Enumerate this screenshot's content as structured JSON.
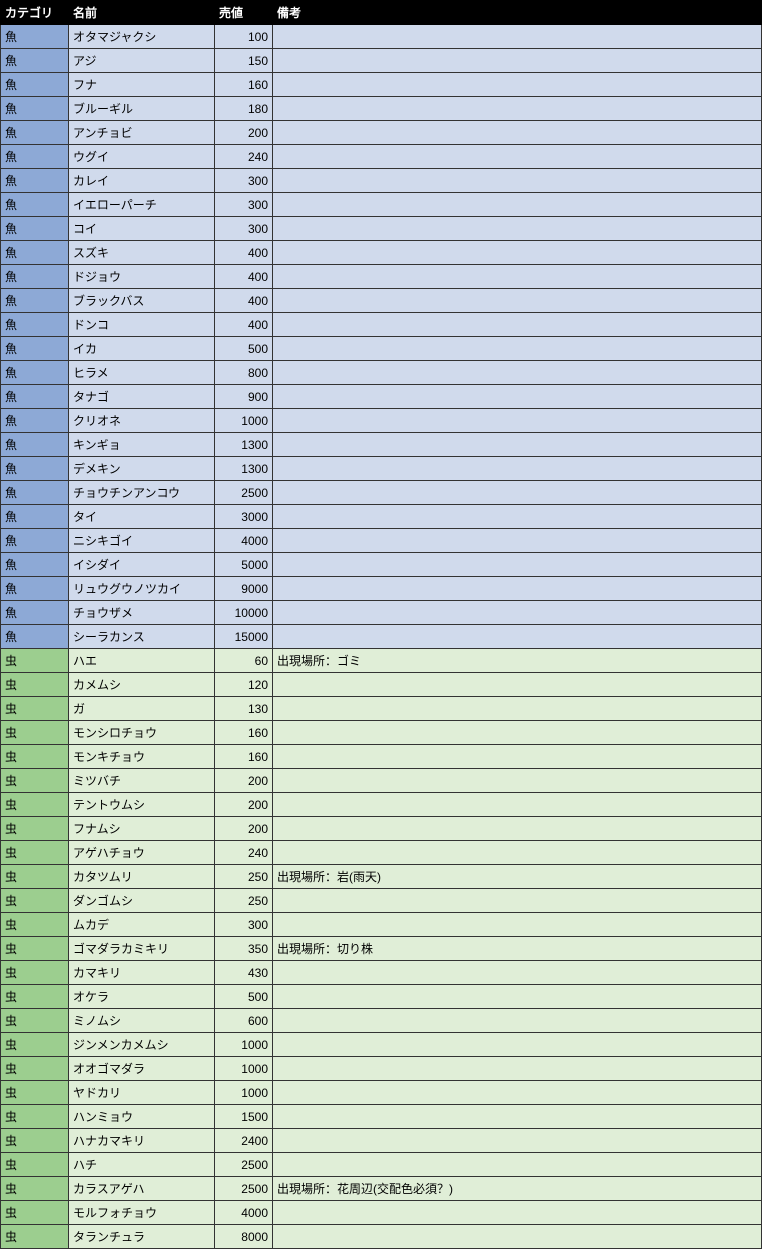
{
  "headers": {
    "category": "カテゴリ",
    "name": "名前",
    "price": "売値",
    "note": "備考"
  },
  "rows": [
    {
      "category": "魚",
      "name": "オタマジャクシ",
      "price": 100,
      "note": "",
      "type": "fish"
    },
    {
      "category": "魚",
      "name": "アジ",
      "price": 150,
      "note": "",
      "type": "fish"
    },
    {
      "category": "魚",
      "name": "フナ",
      "price": 160,
      "note": "",
      "type": "fish"
    },
    {
      "category": "魚",
      "name": "ブルーギル",
      "price": 180,
      "note": "",
      "type": "fish"
    },
    {
      "category": "魚",
      "name": "アンチョビ",
      "price": 200,
      "note": "",
      "type": "fish"
    },
    {
      "category": "魚",
      "name": "ウグイ",
      "price": 240,
      "note": "",
      "type": "fish"
    },
    {
      "category": "魚",
      "name": "カレイ",
      "price": 300,
      "note": "",
      "type": "fish"
    },
    {
      "category": "魚",
      "name": "イエローパーチ",
      "price": 300,
      "note": "",
      "type": "fish"
    },
    {
      "category": "魚",
      "name": "コイ",
      "price": 300,
      "note": "",
      "type": "fish"
    },
    {
      "category": "魚",
      "name": "スズキ",
      "price": 400,
      "note": "",
      "type": "fish"
    },
    {
      "category": "魚",
      "name": "ドジョウ",
      "price": 400,
      "note": "",
      "type": "fish"
    },
    {
      "category": "魚",
      "name": "ブラックバス",
      "price": 400,
      "note": "",
      "type": "fish"
    },
    {
      "category": "魚",
      "name": "ドンコ",
      "price": 400,
      "note": "",
      "type": "fish"
    },
    {
      "category": "魚",
      "name": "イカ",
      "price": 500,
      "note": "",
      "type": "fish"
    },
    {
      "category": "魚",
      "name": "ヒラメ",
      "price": 800,
      "note": "",
      "type": "fish"
    },
    {
      "category": "魚",
      "name": "タナゴ",
      "price": 900,
      "note": "",
      "type": "fish"
    },
    {
      "category": "魚",
      "name": "クリオネ",
      "price": 1000,
      "note": "",
      "type": "fish"
    },
    {
      "category": "魚",
      "name": "キンギョ",
      "price": 1300,
      "note": "",
      "type": "fish"
    },
    {
      "category": "魚",
      "name": "デメキン",
      "price": 1300,
      "note": "",
      "type": "fish"
    },
    {
      "category": "魚",
      "name": "チョウチンアンコウ",
      "price": 2500,
      "note": "",
      "type": "fish"
    },
    {
      "category": "魚",
      "name": "タイ",
      "price": 3000,
      "note": "",
      "type": "fish"
    },
    {
      "category": "魚",
      "name": "ニシキゴイ",
      "price": 4000,
      "note": "",
      "type": "fish"
    },
    {
      "category": "魚",
      "name": "イシダイ",
      "price": 5000,
      "note": "",
      "type": "fish"
    },
    {
      "category": "魚",
      "name": "リュウグウノツカイ",
      "price": 9000,
      "note": "",
      "type": "fish"
    },
    {
      "category": "魚",
      "name": "チョウザメ",
      "price": 10000,
      "note": "",
      "type": "fish"
    },
    {
      "category": "魚",
      "name": "シーラカンス",
      "price": 15000,
      "note": "",
      "type": "fish"
    },
    {
      "category": "虫",
      "name": "ハエ",
      "price": 60,
      "note": "出現場所：ゴミ",
      "type": "bug"
    },
    {
      "category": "虫",
      "name": "カメムシ",
      "price": 120,
      "note": "",
      "type": "bug"
    },
    {
      "category": "虫",
      "name": "ガ",
      "price": 130,
      "note": "",
      "type": "bug"
    },
    {
      "category": "虫",
      "name": "モンシロチョウ",
      "price": 160,
      "note": "",
      "type": "bug"
    },
    {
      "category": "虫",
      "name": "モンキチョウ",
      "price": 160,
      "note": "",
      "type": "bug"
    },
    {
      "category": "虫",
      "name": "ミツバチ",
      "price": 200,
      "note": "",
      "type": "bug"
    },
    {
      "category": "虫",
      "name": "テントウムシ",
      "price": 200,
      "note": "",
      "type": "bug"
    },
    {
      "category": "虫",
      "name": "フナムシ",
      "price": 200,
      "note": "",
      "type": "bug"
    },
    {
      "category": "虫",
      "name": "アゲハチョウ",
      "price": 240,
      "note": "",
      "type": "bug"
    },
    {
      "category": "虫",
      "name": "カタツムリ",
      "price": 250,
      "note": "出現場所：岩(雨天)",
      "type": "bug"
    },
    {
      "category": "虫",
      "name": "ダンゴムシ",
      "price": 250,
      "note": "",
      "type": "bug"
    },
    {
      "category": "虫",
      "name": "ムカデ",
      "price": 300,
      "note": "",
      "type": "bug"
    },
    {
      "category": "虫",
      "name": "ゴマダラカミキリ",
      "price": 350,
      "note": "出現場所：切り株",
      "type": "bug"
    },
    {
      "category": "虫",
      "name": "カマキリ",
      "price": 430,
      "note": "",
      "type": "bug"
    },
    {
      "category": "虫",
      "name": "オケラ",
      "price": 500,
      "note": "",
      "type": "bug"
    },
    {
      "category": "虫",
      "name": "ミノムシ",
      "price": 600,
      "note": "",
      "type": "bug"
    },
    {
      "category": "虫",
      "name": "ジンメンカメムシ",
      "price": 1000,
      "note": "",
      "type": "bug"
    },
    {
      "category": "虫",
      "name": "オオゴマダラ",
      "price": 1000,
      "note": "",
      "type": "bug"
    },
    {
      "category": "虫",
      "name": "ヤドカリ",
      "price": 1000,
      "note": "",
      "type": "bug"
    },
    {
      "category": "虫",
      "name": "ハンミョウ",
      "price": 1500,
      "note": "",
      "type": "bug"
    },
    {
      "category": "虫",
      "name": "ハナカマキリ",
      "price": 2400,
      "note": "",
      "type": "bug"
    },
    {
      "category": "虫",
      "name": "ハチ",
      "price": 2500,
      "note": "",
      "type": "bug"
    },
    {
      "category": "虫",
      "name": "カラスアゲハ",
      "price": 2500,
      "note": "出現場所：花周辺(交配色必須？)",
      "type": "bug"
    },
    {
      "category": "虫",
      "name": "モルフォチョウ",
      "price": 4000,
      "note": "",
      "type": "bug"
    },
    {
      "category": "虫",
      "name": "タランチュラ",
      "price": 8000,
      "note": "",
      "type": "bug"
    }
  ]
}
